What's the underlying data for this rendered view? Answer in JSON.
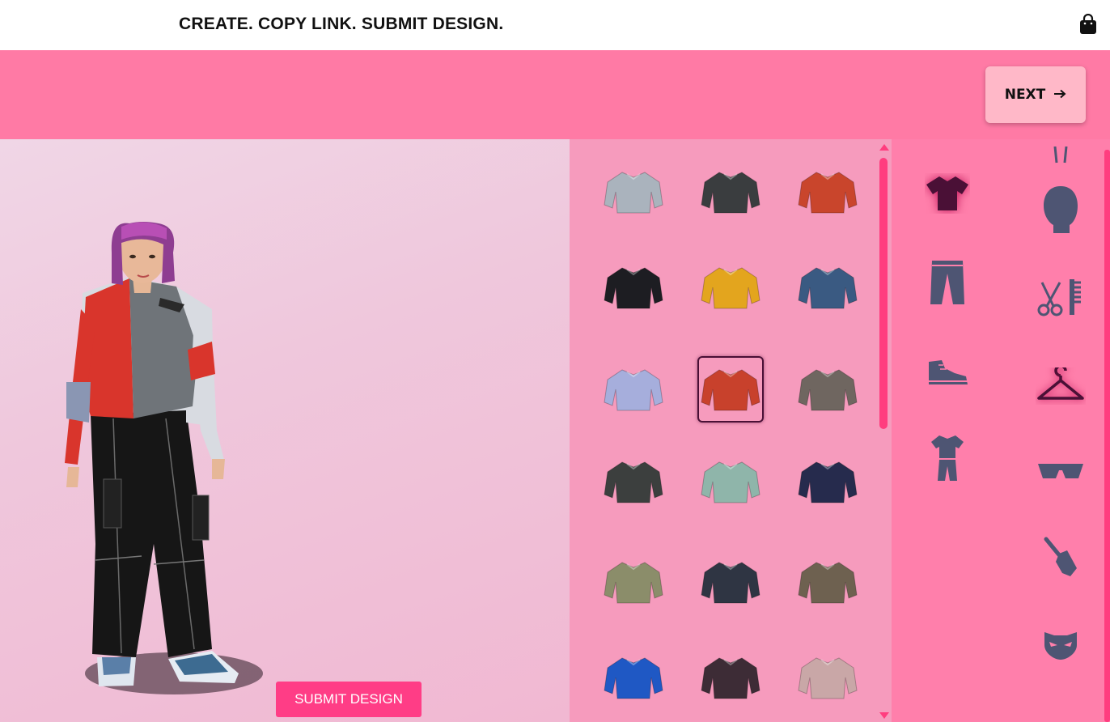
{
  "header": {
    "slogan": "CREATE. COPY LINK. SUBMIT DESIGN.",
    "cart_icon": "shopping-bag-icon"
  },
  "toolbar": {
    "next_label": "NEXT",
    "next_icon": "arrow-right-icon"
  },
  "stage": {
    "submit_label": "SUBMIT DESIGN"
  },
  "colors": {
    "brand_pink": "#ff7aa5",
    "accent": "#ff3d86",
    "panel_pink": "#f69bbd",
    "category_bg": "#ff7fab",
    "icon_default": "#4e5573",
    "icon_active": "#4a1036"
  },
  "outfits": [
    {
      "id": "grey-tshirt",
      "color": "#aab3bd"
    },
    {
      "id": "black-bomber",
      "color": "#3a3d3f"
    },
    {
      "id": "red-puffer",
      "color": "#c9452c"
    },
    {
      "id": "graffiti-vest",
      "color": "#1d1d22"
    },
    {
      "id": "yellow-hoodie",
      "color": "#e3a51e"
    },
    {
      "id": "denim-jacket",
      "color": "#3a5a82"
    },
    {
      "id": "holo-puffer",
      "color": "#a6aedc"
    },
    {
      "id": "red-grey-tee",
      "color": "#c8412c",
      "selected": true
    },
    {
      "id": "grey-trench",
      "color": "#6f6660"
    },
    {
      "id": "camo-parka",
      "color": "#3c3f3e"
    },
    {
      "id": "mint-hoodie",
      "color": "#8fb5aa"
    },
    {
      "id": "navy-hoodie",
      "color": "#262b4d"
    },
    {
      "id": "floral-hoodie",
      "color": "#8b8d6a"
    },
    {
      "id": "charcoal-sweater",
      "color": "#2f3543"
    },
    {
      "id": "olive-sweater",
      "color": "#6e6150"
    },
    {
      "id": "blue-sweatshirt",
      "color": "#1f58c4"
    },
    {
      "id": "plum-hoodie",
      "color": "#3d2c36"
    },
    {
      "id": "pastel-hoodie",
      "color": "#c9a7a7"
    }
  ],
  "categories_left": [
    {
      "name": "tshirt-icon",
      "active": true
    },
    {
      "name": "pants-icon",
      "active": false
    },
    {
      "name": "sneaker-icon",
      "active": false
    },
    {
      "name": "outfit-icon",
      "active": false
    }
  ],
  "categories_right": [
    {
      "name": "head-icon",
      "active": false
    },
    {
      "name": "scissors-comb-icon",
      "active": false
    },
    {
      "name": "hanger-icon",
      "active": true
    },
    {
      "name": "sunglasses-icon",
      "active": false
    },
    {
      "name": "makeup-brush-icon",
      "active": false
    },
    {
      "name": "mask-icon",
      "active": false
    }
  ]
}
